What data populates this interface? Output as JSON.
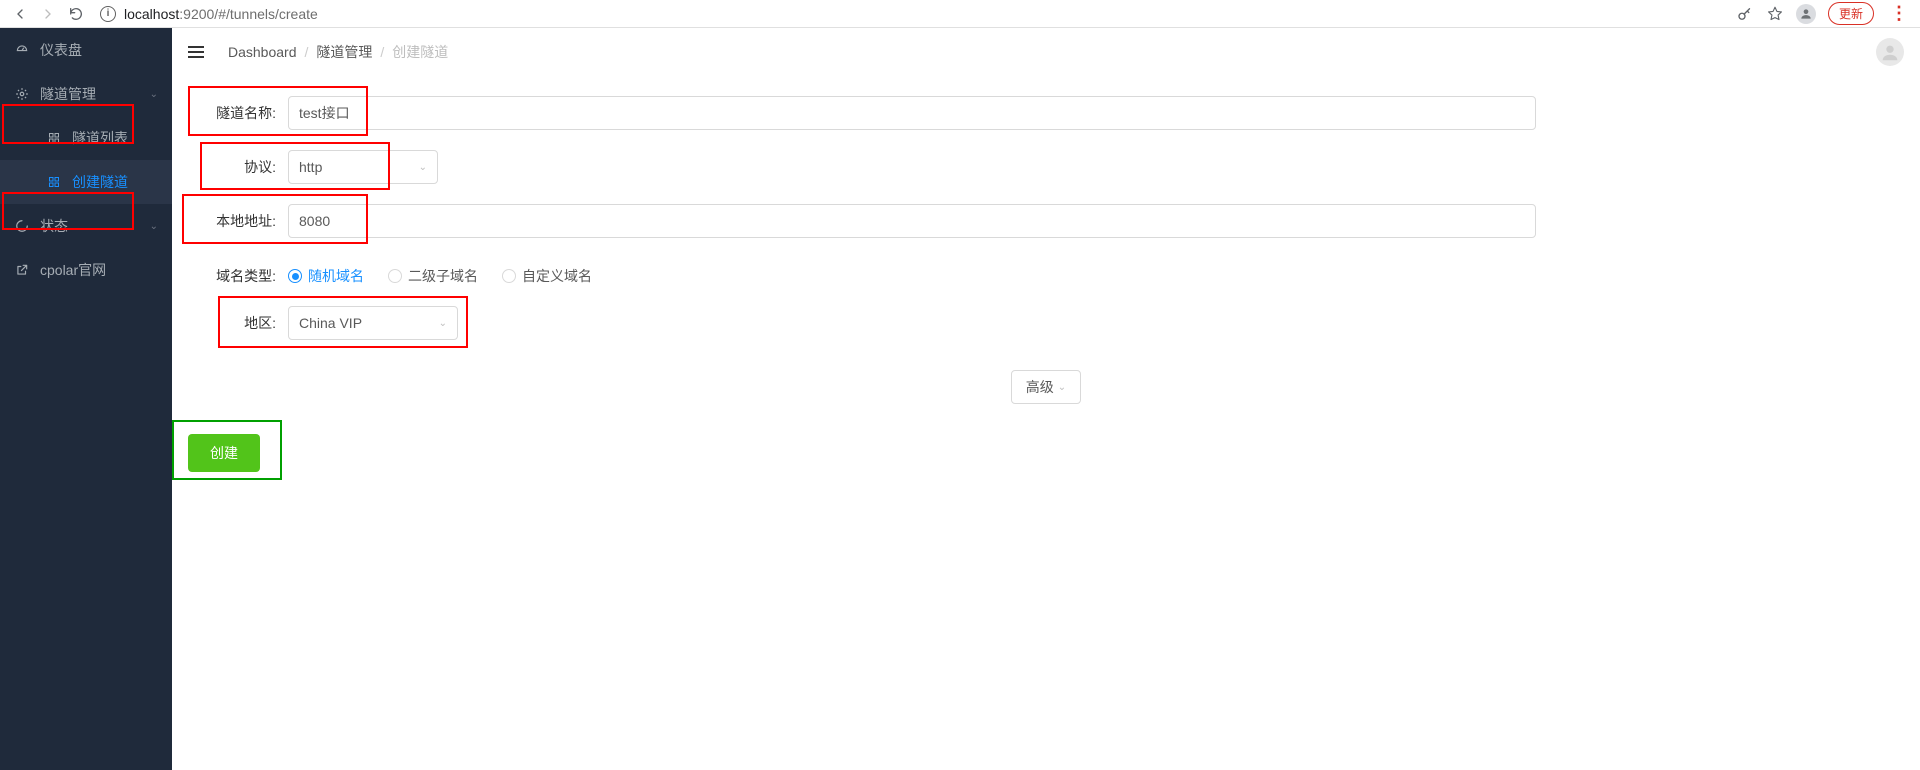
{
  "browser": {
    "url_host": "localhost",
    "url_port_path": ":9200/#/tunnels/create",
    "update_label": "更新"
  },
  "sidebar": {
    "items": [
      {
        "label": "仪表盘",
        "icon": "dashboard"
      },
      {
        "label": "隧道管理",
        "icon": "gear",
        "expanded": true
      },
      {
        "label": "隧道列表",
        "icon": "grid",
        "sub": true
      },
      {
        "label": "创建隧道",
        "icon": "grid",
        "sub": true,
        "active": true
      },
      {
        "label": "状态",
        "icon": "loading",
        "expanded": false
      },
      {
        "label": "cpolar官网",
        "icon": "external"
      }
    ]
  },
  "breadcrumb": {
    "items": [
      "Dashboard",
      "隧道管理",
      "创建隧道"
    ]
  },
  "form": {
    "name_label": "隧道名称:",
    "name_value": "test接口",
    "proto_label": "协议:",
    "proto_value": "http",
    "addr_label": "本地地址:",
    "addr_value": "8080",
    "domain_label": "域名类型:",
    "domain_options": [
      {
        "label": "随机域名",
        "checked": true
      },
      {
        "label": "二级子域名",
        "checked": false
      },
      {
        "label": "自定义域名",
        "checked": false
      }
    ],
    "region_label": "地区:",
    "region_value": "China VIP",
    "advanced_label": "高级",
    "submit_label": "创建"
  }
}
